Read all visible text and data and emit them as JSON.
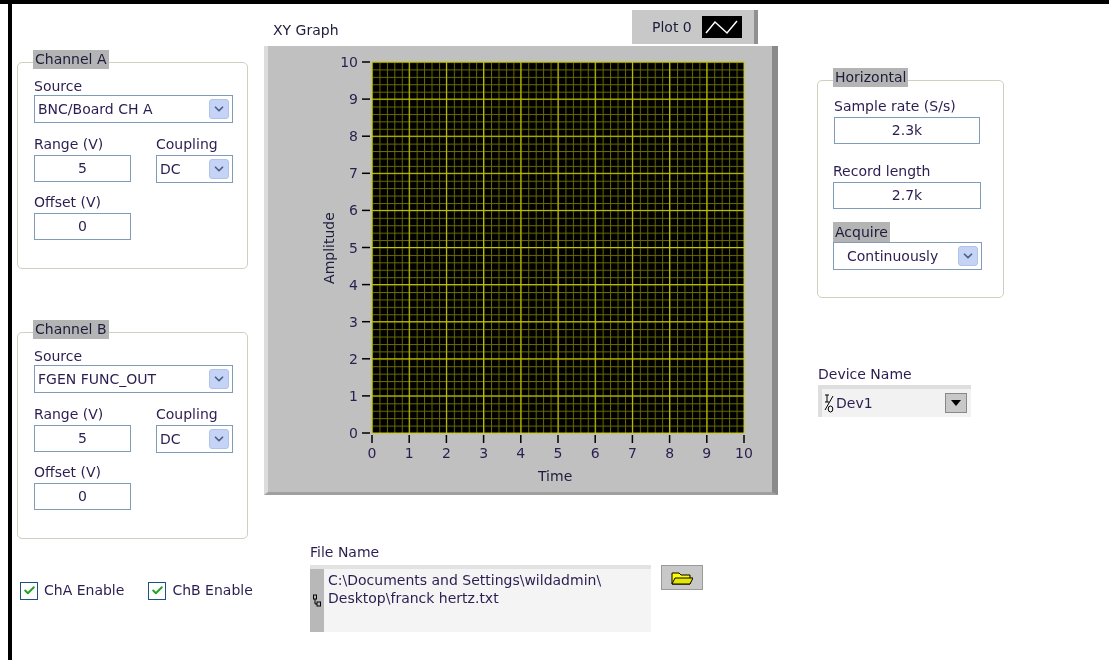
{
  "channels": [
    {
      "title": "Channel A",
      "source": {
        "label": "Source",
        "value": "BNC/Board CH A"
      },
      "range": {
        "label": "Range (V)",
        "value": "5"
      },
      "coupling": {
        "label": "Coupling",
        "value": "DC"
      },
      "offset": {
        "label": "Offset (V)",
        "value": "0"
      }
    },
    {
      "title": "Channel B",
      "source": {
        "label": "Source",
        "value": "FGEN FUNC_OUT"
      },
      "range": {
        "label": "Range (V)",
        "value": "5"
      },
      "coupling": {
        "label": "Coupling",
        "value": "DC"
      },
      "offset": {
        "label": "Offset (V)",
        "value": "0"
      }
    }
  ],
  "enables": [
    {
      "label": "ChA Enable",
      "checked": true
    },
    {
      "label": "ChB Enable",
      "checked": true
    }
  ],
  "graph": {
    "title": "XY Graph",
    "legend": {
      "label": "Plot 0"
    },
    "chart_data": {
      "type": "line",
      "xlabel": "Time",
      "ylabel": "Amplitude",
      "xlim": [
        0,
        10
      ],
      "ylim": [
        0,
        10
      ],
      "xticks": [
        0,
        1,
        2,
        3,
        4,
        5,
        6,
        7,
        8,
        9,
        10
      ],
      "yticks": [
        0,
        1,
        2,
        3,
        4,
        5,
        6,
        7,
        8,
        9,
        10
      ],
      "grid": true
    }
  },
  "horizontal": {
    "title": "Horizontal",
    "sample_rate": {
      "label": "Sample rate (S/s)",
      "value": "2.3k"
    },
    "record_length": {
      "label": "Record length",
      "value": "2.7k"
    },
    "acquire": {
      "label": "Acquire",
      "value": "Continuously"
    }
  },
  "device": {
    "label": "Device Name",
    "value": "Dev1"
  },
  "file": {
    "label": "File Name",
    "lines": [
      "C:\\Documents and Settings\\wildadmin\\",
      "Desktop\\franck hertz.txt"
    ]
  }
}
